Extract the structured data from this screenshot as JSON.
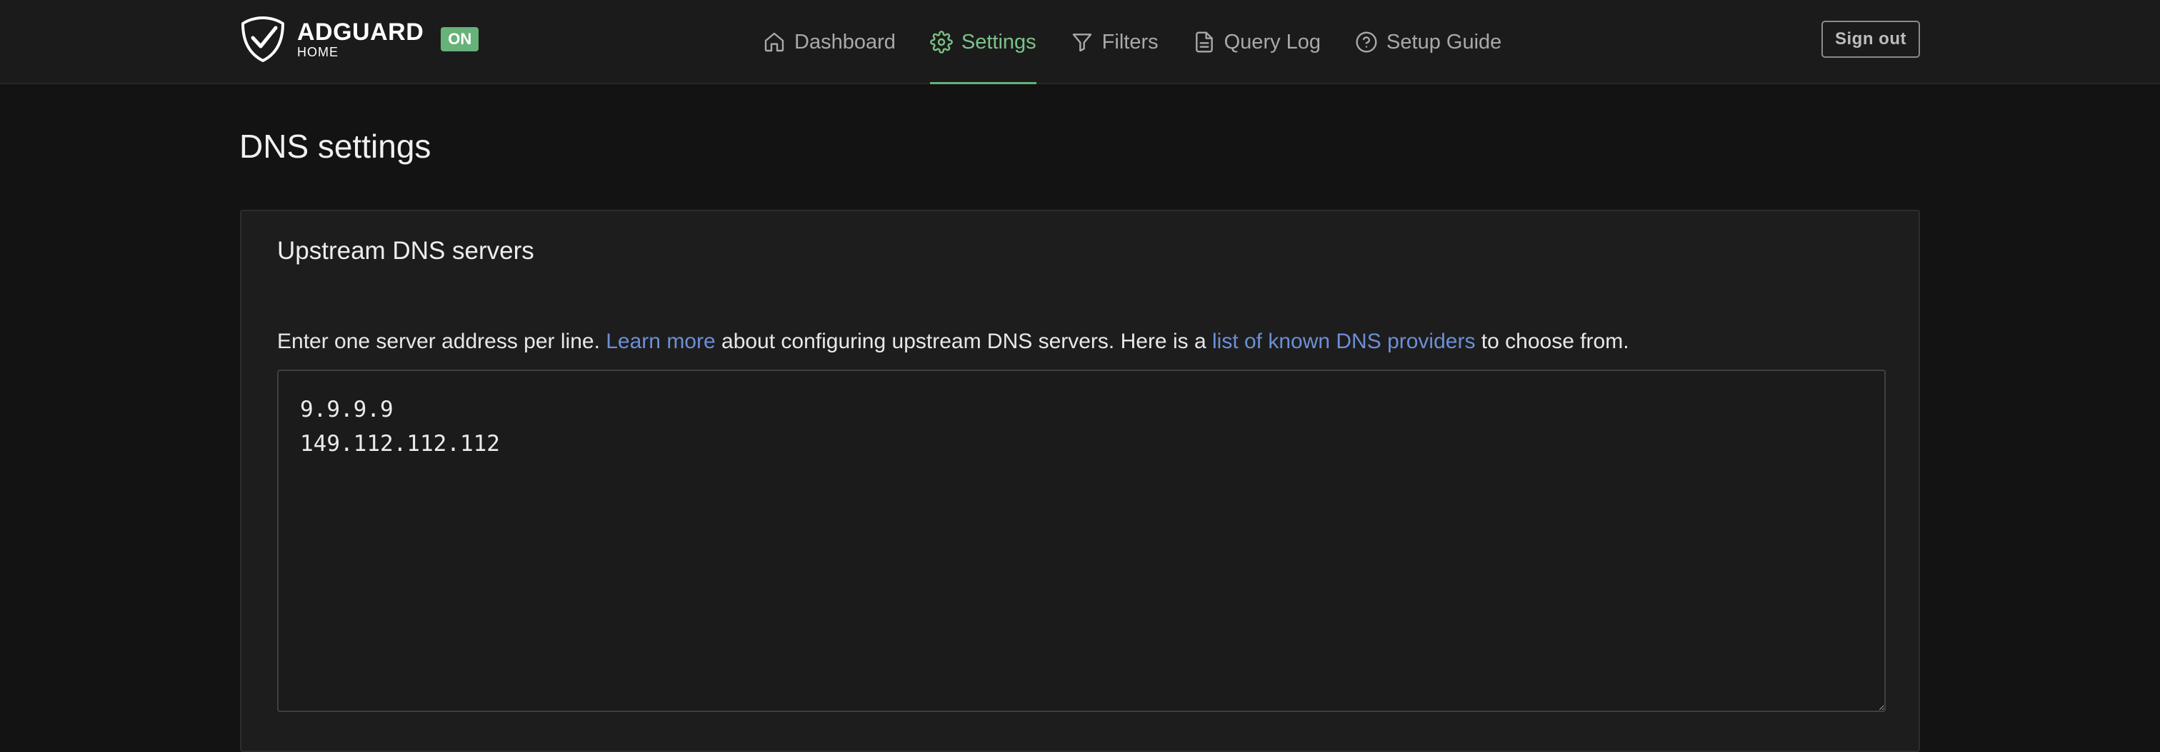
{
  "logo": {
    "title": "ADGUARD",
    "subtitle": "HOME",
    "badge": "ON"
  },
  "nav": [
    {
      "label": "Dashboard",
      "icon": "home-icon",
      "active": false
    },
    {
      "label": "Settings",
      "icon": "gear-icon",
      "active": true
    },
    {
      "label": "Filters",
      "icon": "filter-icon",
      "active": false
    },
    {
      "label": "Query Log",
      "icon": "document-icon",
      "active": false
    },
    {
      "label": "Setup Guide",
      "icon": "help-circle-icon",
      "active": false
    }
  ],
  "header": {
    "signout_label": "Sign out"
  },
  "page": {
    "title": "DNS settings"
  },
  "upstream": {
    "title": "Upstream DNS servers",
    "desc_prefix": "Enter one server address per line. ",
    "learn_more": "Learn more",
    "desc_middle": " about configuring upstream DNS servers. Here is a ",
    "providers_link": "list of known DNS providers",
    "desc_suffix": " to choose from.",
    "servers_value": "9.9.9.9\n149.112.112.112"
  },
  "colors": {
    "accent": "#67b279",
    "link": "#6c8fd6",
    "background": "#131313",
    "header": "#1b1b1b"
  }
}
